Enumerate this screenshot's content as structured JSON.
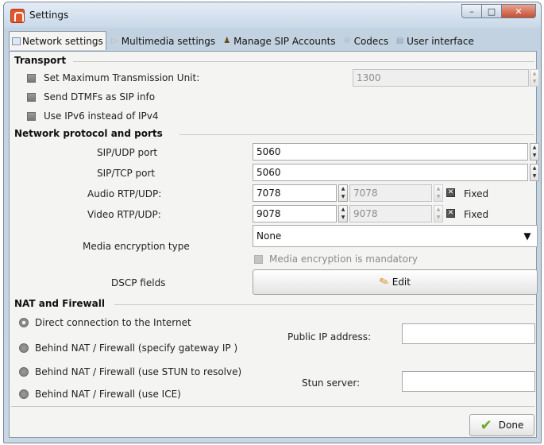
{
  "window": {
    "title": "Settings"
  },
  "tabs": [
    {
      "label": "Network settings",
      "active": true,
      "icon": "network-icon"
    },
    {
      "label": "Multimedia settings",
      "active": false,
      "icon": "play-icon"
    },
    {
      "label": "Manage SIP Accounts",
      "active": false,
      "icon": "users-icon"
    },
    {
      "label": "Codecs",
      "active": false,
      "icon": "codec-icon"
    },
    {
      "label": "User interface",
      "active": false,
      "icon": "ui-icon"
    }
  ],
  "transport": {
    "title": "Transport",
    "mtu_label": "Set Maximum Transmission Unit:",
    "mtu_value": "1300",
    "dtmf_label": "Send DTMFs as SIP info",
    "ipv6_label": "Use IPv6 instead of IPv4"
  },
  "ports": {
    "title": "Network protocol and ports",
    "sip_udp_label": "SIP/UDP port",
    "sip_udp_value": "5060",
    "sip_tcp_label": "SIP/TCP port",
    "sip_tcp_value": "5060",
    "audio_label": "Audio RTP/UDP:",
    "audio_min": "7078",
    "audio_max": "7078",
    "video_label": "Video RTP/UDP:",
    "video_min": "9078",
    "video_max": "9078",
    "fixed_label": "Fixed",
    "encryption_label": "Media encryption type",
    "encryption_value": "None",
    "encryption_mandatory_label": "Media encryption is mandatory",
    "dscp_label": "DSCP fields",
    "edit_label": "Edit"
  },
  "nat": {
    "title": "NAT and Firewall",
    "options": [
      {
        "label": "Direct connection to the Internet",
        "checked": true
      },
      {
        "label": "Behind NAT / Firewall (specify gateway IP )",
        "checked": false
      },
      {
        "label": "Behind NAT / Firewall (use STUN to resolve)",
        "checked": false
      },
      {
        "label": "Behind NAT / Firewall (use ICE)",
        "checked": false
      }
    ],
    "public_ip_label": "Public IP address:",
    "public_ip_value": "",
    "stun_label": "Stun server:",
    "stun_value": ""
  },
  "footer": {
    "done_label": "Done"
  }
}
